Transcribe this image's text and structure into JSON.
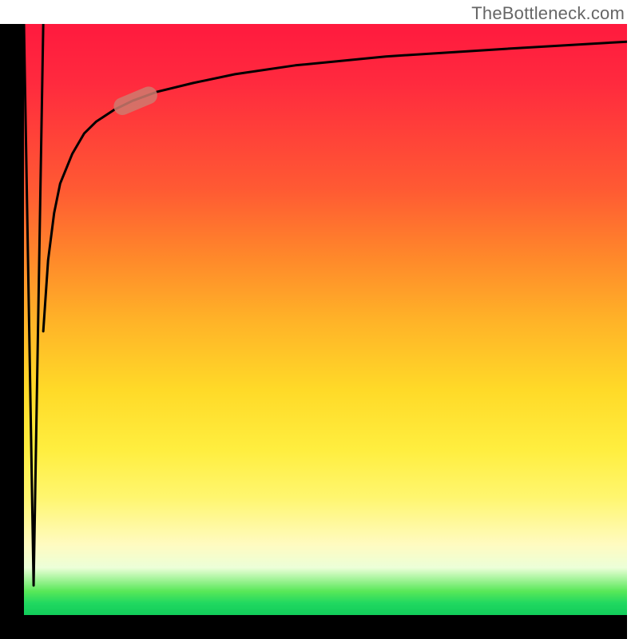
{
  "watermark": "TheBottleneck.com",
  "colors": {
    "axis": "#000000",
    "curve": "#000000",
    "highlight": "#cf7a6e",
    "gradient_top": "#ff1a3e",
    "gradient_bottom": "#12cc5a"
  },
  "chart_data": {
    "type": "line",
    "title": "",
    "xlabel": "",
    "ylabel": "",
    "xlim": [
      0,
      100
    ],
    "ylim": [
      0,
      100
    ],
    "grid": false,
    "legend": false,
    "annotations": [
      {
        "kind": "watermark",
        "text": "TheBottleneck.com",
        "position": "top-right"
      },
      {
        "kind": "highlight",
        "shape": "pill",
        "on_curve": true,
        "x_range": [
          15,
          22
        ]
      }
    ],
    "series": [
      {
        "name": "dip-spike",
        "x": [
          0,
          1.6,
          3.2
        ],
        "y": [
          100,
          5,
          100
        ]
      },
      {
        "name": "log-curve",
        "x": [
          3.2,
          4,
          5,
          6,
          8,
          10,
          12,
          15,
          18,
          22,
          28,
          35,
          45,
          60,
          80,
          100
        ],
        "y": [
          48,
          60,
          68,
          73,
          78,
          81.5,
          83.5,
          85.5,
          87,
          88.5,
          90,
          91.5,
          93,
          94.5,
          95.8,
          97
        ]
      }
    ]
  }
}
